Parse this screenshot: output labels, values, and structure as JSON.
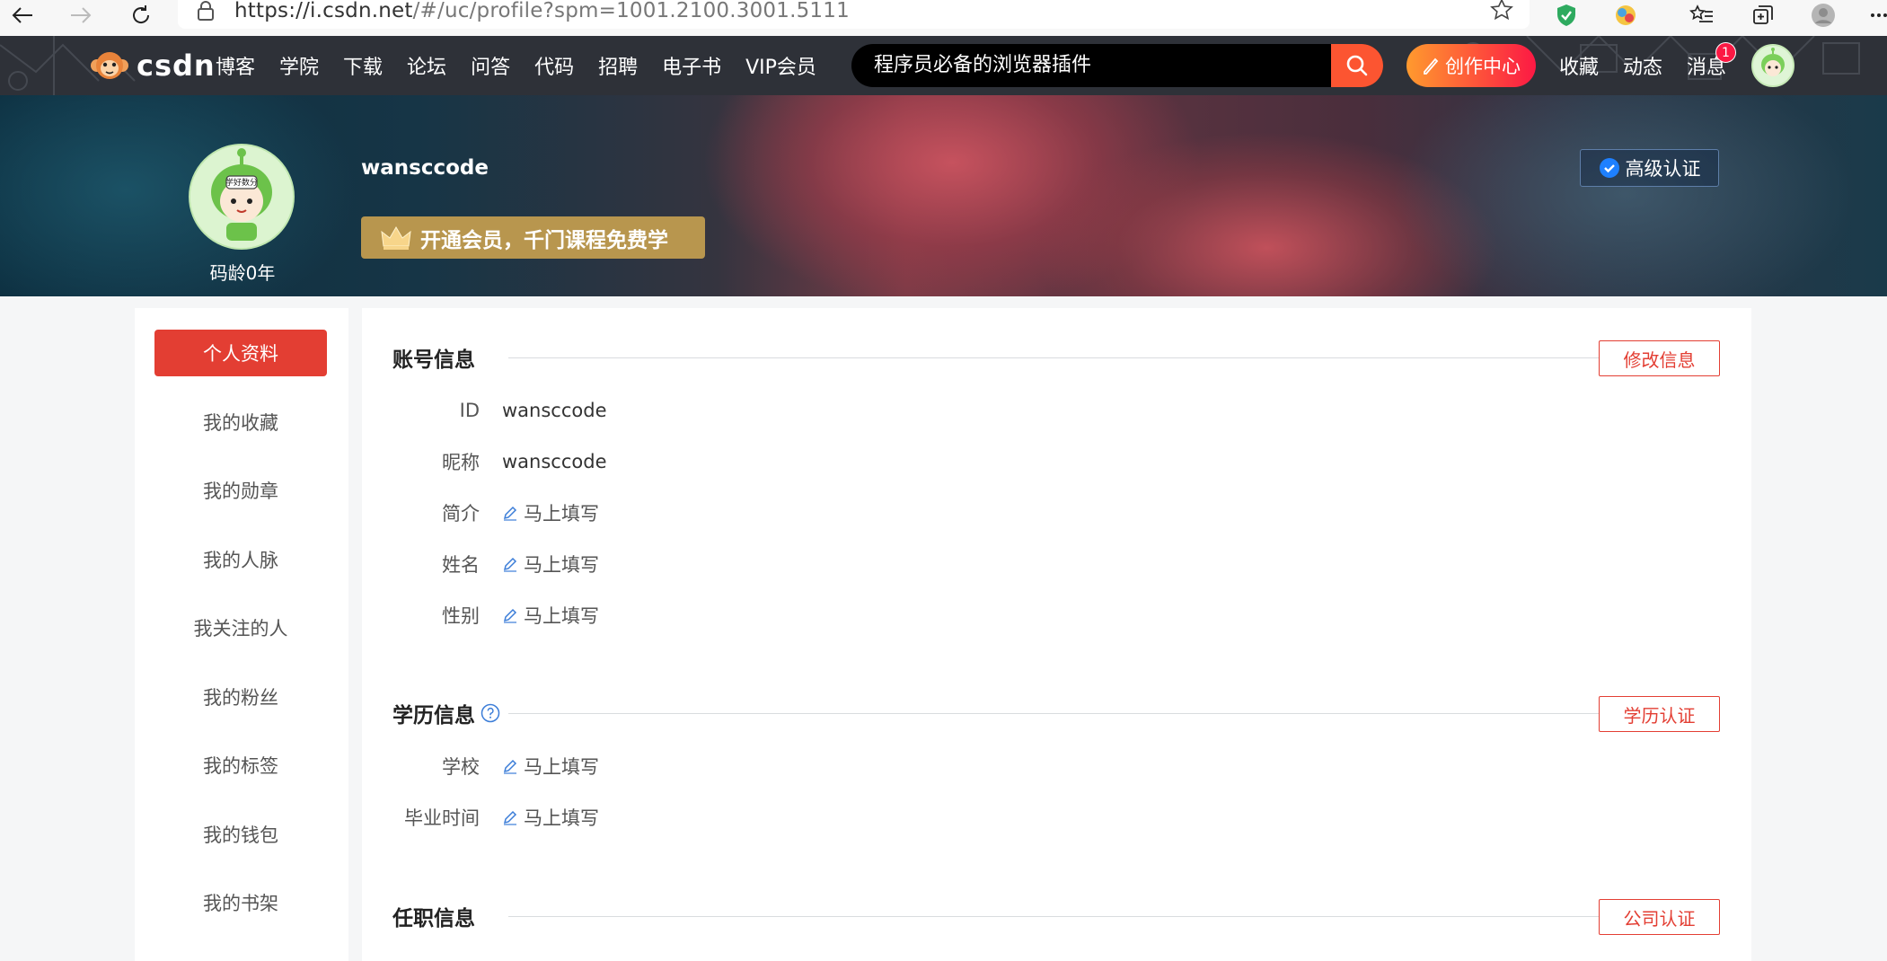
{
  "browser": {
    "url_host": "https://i.csdn.net",
    "url_path": "/#/uc/profile?spm=1001.2100.3001.5111"
  },
  "nav": {
    "logo_text": "csdn",
    "items": [
      "博客",
      "学院",
      "下载",
      "论坛",
      "问答",
      "代码",
      "招聘",
      "电子书",
      "VIP会员"
    ],
    "search_placeholder": "程序员必备的浏览器插件",
    "create_label": "创作中心",
    "right_items": [
      "收藏",
      "动态",
      "消息"
    ],
    "message_badge": "1"
  },
  "profile": {
    "username": "wansccode",
    "code_age": "码龄0年",
    "vip_promo": "开通会员，千门课程免费学",
    "cert_label": "高级认证",
    "avatar_text": "学好数分"
  },
  "sidebar": {
    "items": [
      "个人资料",
      "我的收藏",
      "我的勋章",
      "我的人脉",
      "我关注的人",
      "我的粉丝",
      "我的标签",
      "我的钱包",
      "我的书架"
    ],
    "active_index": 0
  },
  "account": {
    "title": "账号信息",
    "edit_button": "修改信息",
    "fields": [
      {
        "label": "ID",
        "value": "wansccode"
      },
      {
        "label": "昵称",
        "value": "wansccode"
      },
      {
        "label": "简介",
        "value": "马上填写"
      },
      {
        "label": "姓名",
        "value": "马上填写"
      },
      {
        "label": "性别",
        "value": "马上填写"
      }
    ]
  },
  "education": {
    "title": "学历信息",
    "cert_button": "学历认证",
    "fields": [
      {
        "label": "学校",
        "value": "马上填写"
      },
      {
        "label": "毕业时间",
        "value": "马上填写"
      }
    ]
  },
  "employment": {
    "title": "任职信息",
    "cert_button": "公司认证"
  },
  "colors": {
    "brand_red": "#e33e33",
    "nav_bg": "#2e3138",
    "search_btn": "#fc5531",
    "vip_gold": "#b8964e"
  }
}
